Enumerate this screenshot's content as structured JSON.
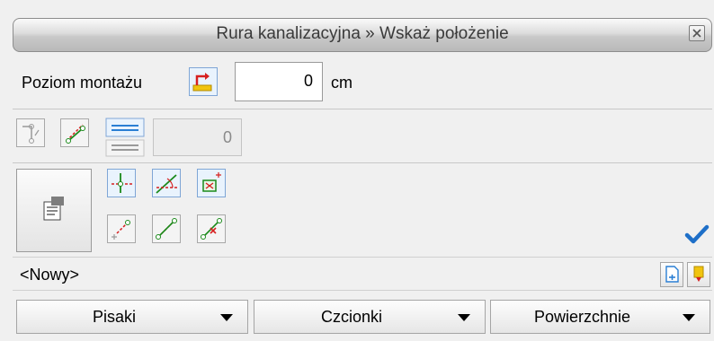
{
  "window": {
    "title": "Rura kanalizacyjna » Wskaż położenie"
  },
  "mounting": {
    "label": "Poziom montażu",
    "value": "0",
    "unit": "cm"
  },
  "offset_field": {
    "value": "0"
  },
  "name_bar": {
    "value": "<Nowy>"
  },
  "bottom_buttons": [
    {
      "label": "Pisaki"
    },
    {
      "label": "Czcionki"
    },
    {
      "label": "Powierzchnie"
    }
  ],
  "colors": {
    "accent_blue": "#2a7fd4",
    "tool_red": "#d62020",
    "tool_green": "#1a8a1a",
    "confirm_blue": "#1e6fc8"
  }
}
